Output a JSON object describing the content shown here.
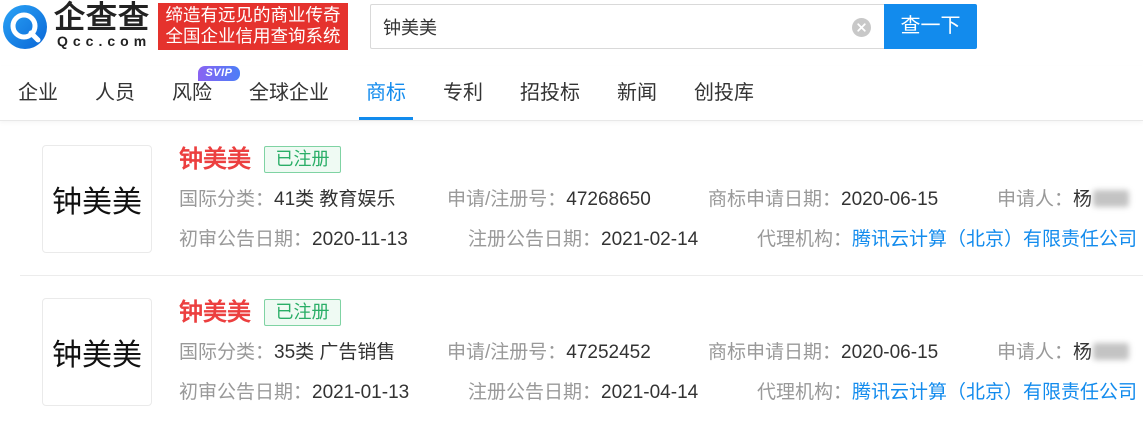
{
  "header": {
    "logo": {
      "icon": "qcc-logo-icon",
      "brand": "企查查",
      "domain": "Qcc.com"
    },
    "slogan": {
      "line1": "缔造有远见的商业传奇",
      "line2": "全国企业信用查询系统"
    },
    "search": {
      "value": "钟美美",
      "clear_icon": "close-circle-icon",
      "button_label": "查一下"
    }
  },
  "nav": {
    "tabs": [
      {
        "label": "企业"
      },
      {
        "label": "人员"
      },
      {
        "label": "风险",
        "badge": "SVIP"
      },
      {
        "label": "全球企业"
      },
      {
        "label": "商标",
        "active": true
      },
      {
        "label": "专利"
      },
      {
        "label": "招投标"
      },
      {
        "label": "新闻"
      },
      {
        "label": "创投库"
      }
    ]
  },
  "results": [
    {
      "thumbnail_text": "钟美美",
      "name": "钟美美",
      "status": "已注册",
      "fields": {
        "intl_class": {
          "label": "国际分类：",
          "value": "41类 教育娱乐"
        },
        "reg_no": {
          "label": "申请/注册号：",
          "value": "47268650"
        },
        "apply_date": {
          "label": "商标申请日期：",
          "value": "2020-06-15"
        },
        "applicant": {
          "label": "申请人：",
          "value": "杨"
        },
        "prelim_pub_date": {
          "label": "初审公告日期：",
          "value": "2020-11-13"
        },
        "reg_pub_date": {
          "label": "注册公告日期：",
          "value": "2021-02-14"
        },
        "agency": {
          "label": "代理机构：",
          "value": "腾讯云计算（北京）有限责任公司"
        }
      }
    },
    {
      "thumbnail_text": "钟美美",
      "name": "钟美美",
      "status": "已注册",
      "fields": {
        "intl_class": {
          "label": "国际分类：",
          "value": "35类 广告销售"
        },
        "reg_no": {
          "label": "申请/注册号：",
          "value": "47252452"
        },
        "apply_date": {
          "label": "商标申请日期：",
          "value": "2020-06-15"
        },
        "applicant": {
          "label": "申请人：",
          "value": "杨"
        },
        "prelim_pub_date": {
          "label": "初审公告日期：",
          "value": "2021-01-13"
        },
        "reg_pub_date": {
          "label": "注册公告日期：",
          "value": "2021-04-14"
        },
        "agency": {
          "label": "代理机构：",
          "value": "腾讯云计算（北京）有限责任公司"
        }
      }
    }
  ],
  "colors": {
    "accent": "#128bed",
    "slogan_bg": "#e5322d",
    "title_red": "#ec3f3f",
    "status_green": "#2aae67"
  }
}
